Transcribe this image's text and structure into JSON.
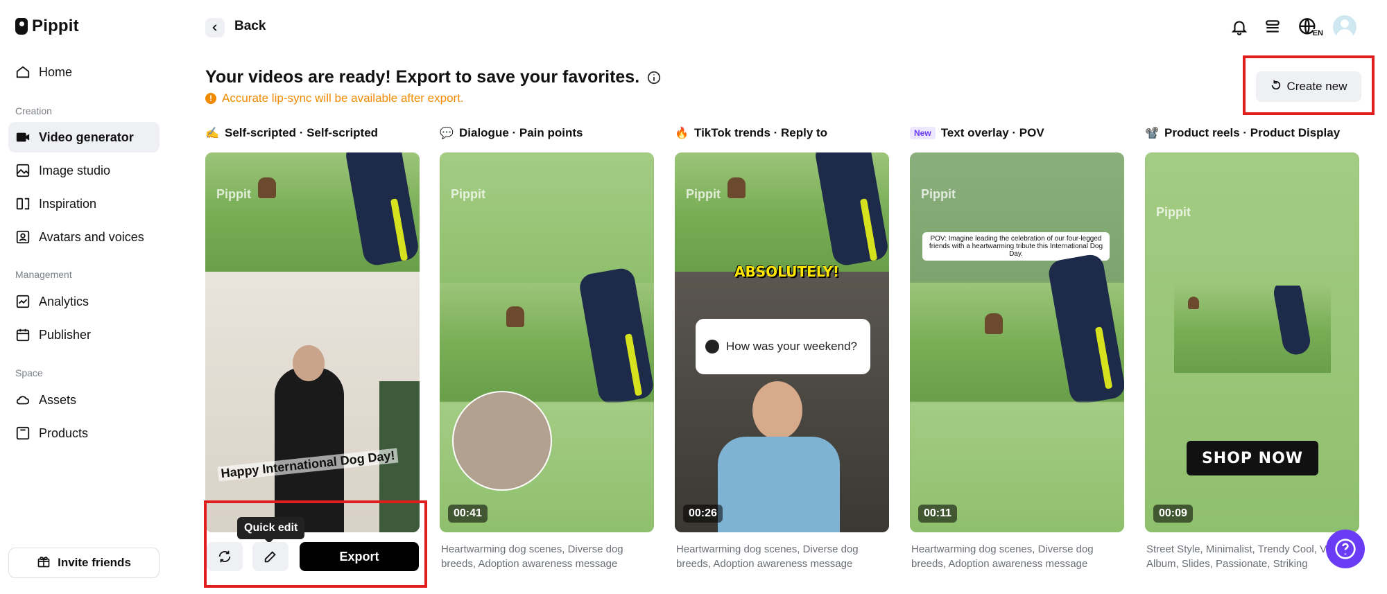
{
  "app": {
    "name": "Pippit"
  },
  "sidebar": {
    "items": [
      {
        "label": "Home",
        "icon": "home-icon"
      },
      {
        "label": "Video generator",
        "icon": "video-generator-icon",
        "active": true
      },
      {
        "label": "Image studio",
        "icon": "image-studio-icon"
      },
      {
        "label": "Inspiration",
        "icon": "inspiration-icon"
      },
      {
        "label": "Avatars and voices",
        "icon": "avatar-icon"
      },
      {
        "label": "Analytics",
        "icon": "analytics-icon"
      },
      {
        "label": "Publisher",
        "icon": "calendar-icon"
      },
      {
        "label": "Assets",
        "icon": "cloud-icon"
      },
      {
        "label": "Products",
        "icon": "products-icon"
      }
    ],
    "sections": {
      "creation": "Creation",
      "management": "Management",
      "space": "Space"
    },
    "invite_label": "Invite friends"
  },
  "header": {
    "back_label": "Back",
    "language_code": "EN",
    "title": "Your videos are ready! Export to save your favorites.",
    "notice": "Accurate lip-sync will be available after export.",
    "create_new_label": "Create new"
  },
  "cards": [
    {
      "emoji": "✍️",
      "title": "Self-scripted · Self-scripted",
      "watermark": "Pippit",
      "caption": "Happy International Dog Day!",
      "tooltip": "Quick edit",
      "export_label": "Export"
    },
    {
      "emoji": "💬",
      "title": "Dialogue · Pain points",
      "watermark": "Pippit",
      "duration": "00:41",
      "description": "Heartwarming dog scenes, Diverse dog breeds, Adoption awareness message"
    },
    {
      "emoji": "🔥",
      "title": "TikTok trends · Reply to",
      "watermark": "Pippit",
      "overlay_text": "ABSOLUTELY!",
      "chat_text": "How was your weekend?",
      "duration": "00:26",
      "description": "Heartwarming dog scenes, Diverse dog breeds, Adoption awareness message"
    },
    {
      "badge": "New",
      "title": "Text overlay · POV",
      "watermark": "Pippit",
      "overlay_text": "POV: Imagine leading the celebration of our four-legged friends with a heartwarming tribute this International Dog Day.",
      "duration": "00:11",
      "description": "Heartwarming dog scenes, Diverse dog breeds, Adoption awareness message"
    },
    {
      "emoji": "📽️",
      "title": "Product reels · Product Display",
      "watermark": "Pippit",
      "overlay_text": "SHOP NOW",
      "duration": "00:09",
      "description": "Street Style, Minimalist, Trendy Cool, Vi... Album, Slides, Passionate, Striking"
    }
  ],
  "colors": {
    "accent": "#6b3cf5",
    "warning": "#f08a00",
    "highlight_frame": "#e01e1e"
  }
}
